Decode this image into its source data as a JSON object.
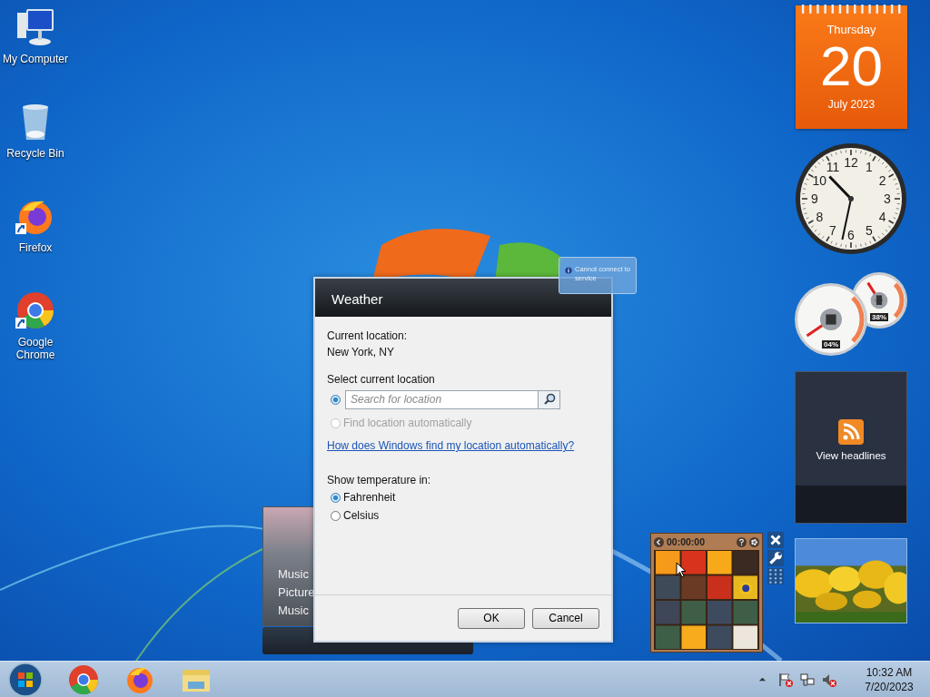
{
  "desktop_icons": [
    {
      "kind": "computer",
      "label": "My Computer",
      "shortcut": false
    },
    {
      "kind": "recycle",
      "label": "Recycle Bin",
      "shortcut": false
    },
    {
      "kind": "firefox",
      "label": "Firefox",
      "shortcut": true
    },
    {
      "kind": "chrome",
      "label": "Google Chrome",
      "shortcut": true
    }
  ],
  "calendar_gadget": {
    "weekday": "Thursday",
    "day": "20",
    "month_year": "July 2023"
  },
  "clock_gadget": {
    "numerals": [
      "12",
      "11",
      "1",
      "10",
      "2",
      "9",
      "3",
      "8",
      "4",
      "7",
      "5",
      "6"
    ]
  },
  "cpu_meter_gadget": {
    "gauges": [
      {
        "kind": "memory",
        "reading": "38%"
      },
      {
        "kind": "cpu",
        "reading": "04%"
      }
    ]
  },
  "feed_gadget": {
    "label": "View headlines"
  },
  "puzzle_gadget": {
    "timer": "00:00:00"
  },
  "media_center_gadget": {
    "items": [
      "Music",
      "Picture",
      "Music"
    ]
  },
  "tooltip": {
    "text": "Cannot connect to service"
  },
  "weather_dialog": {
    "title": "Weather",
    "current_label": "Current location:",
    "current_value": "New York, NY",
    "select_label": "Select current location",
    "location_options": [
      {
        "kind": "search",
        "placeholder": "Search for location",
        "selected": true,
        "disabled": false
      },
      {
        "kind": "auto",
        "label": "Find location automatically",
        "selected": false,
        "disabled": true
      }
    ],
    "help_link": "How does Windows find my location automatically?",
    "units_label": "Show temperature in:",
    "units": [
      {
        "label": "Fahrenheit",
        "selected": true
      },
      {
        "label": "Celsius",
        "selected": false
      }
    ],
    "buttons": [
      "OK",
      "Cancel"
    ]
  },
  "taskbar": {
    "pinned": [
      {
        "kind": "chrome"
      },
      {
        "kind": "firefox"
      },
      {
        "kind": "explorer"
      }
    ],
    "time": "10:32 AM",
    "date": "7/20/2023"
  }
}
